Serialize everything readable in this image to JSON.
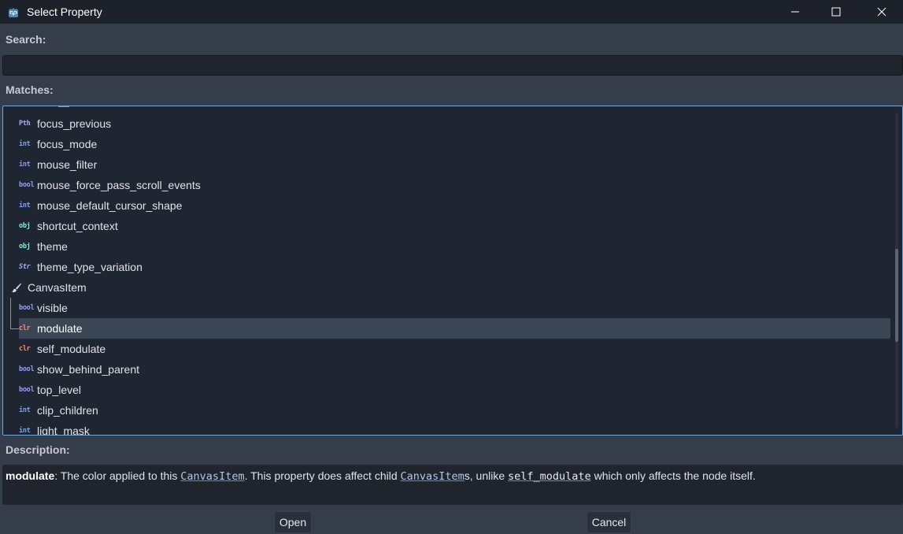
{
  "window": {
    "title": "Select Property",
    "buttons": [
      "minimize",
      "maximize",
      "close"
    ]
  },
  "search": {
    "label": "Search:",
    "value": "",
    "placeholder": ""
  },
  "matches": {
    "label": "Matches:",
    "items": [
      {
        "type": "Pth",
        "type_color": "#a5aef8",
        "name": "focus_previous"
      },
      {
        "type": "int",
        "type_color": "#7da4f0",
        "name": "focus_mode"
      },
      {
        "type": "int",
        "type_color": "#7da4f0",
        "name": "mouse_filter"
      },
      {
        "type": "bool",
        "type_color": "#8ea1f3",
        "name": "mouse_force_pass_scroll_events"
      },
      {
        "type": "int",
        "type_color": "#7da4f0",
        "name": "mouse_default_cursor_shape"
      },
      {
        "type": "obj",
        "type_color": "#7ef0d0",
        "name": "shortcut_context"
      },
      {
        "type": "obj",
        "type_color": "#7ef0d0",
        "name": "theme"
      },
      {
        "type": "Str",
        "type_color": "#96b6ff",
        "name": "theme_type_variation"
      },
      {
        "type": "category",
        "name": "CanvasItem"
      },
      {
        "type": "bool",
        "type_color": "#8ea1f3",
        "name": "visible"
      },
      {
        "type": "clr",
        "type_color": "#ff8d6d",
        "name": "modulate",
        "selected": true
      },
      {
        "type": "clr",
        "type_color": "#ff8d6d",
        "name": "self_modulate"
      },
      {
        "type": "bool",
        "type_color": "#8ea1f3",
        "name": "show_behind_parent"
      },
      {
        "type": "bool",
        "type_color": "#8ea1f3",
        "name": "top_level"
      },
      {
        "type": "int",
        "type_color": "#7da4f0",
        "name": "clip_children"
      },
      {
        "type": "int",
        "type_color": "#7da4f0",
        "name": "light_mask"
      }
    ]
  },
  "description": {
    "label": "Description:",
    "property": "modulate",
    "text_1": ": The color applied to this ",
    "link_1": "CanvasItem",
    "text_2": ". This property does affect child ",
    "link_2": "CanvasItem",
    "text_3": "s, unlike ",
    "link_3": "self_modulate",
    "text_4": " which only affects the node itself."
  },
  "buttons": {
    "open": "Open",
    "cancel": "Cancel"
  },
  "colors": {
    "accent": "#6fa8dc",
    "selection": "#3a4656"
  }
}
